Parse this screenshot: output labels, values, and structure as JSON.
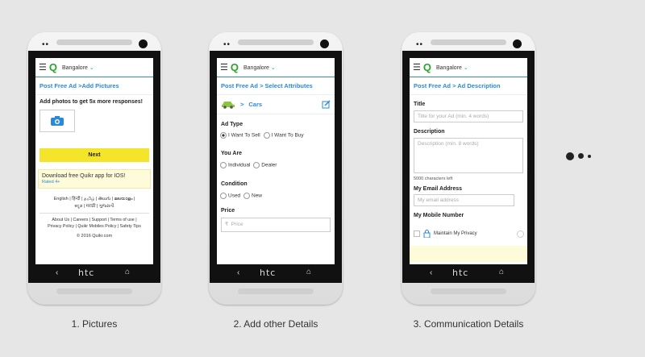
{
  "city": "Bangalore",
  "phones": [
    {
      "caption": "1. Pictures",
      "breadcrumb": "Post Free Ad >Add Pictures",
      "add_photos": "Add photos to get 5x more responses!",
      "next_label": "Next",
      "ios_promo": "Download free Quikr app for IOS!",
      "rated": "Rated 4+",
      "languages_line1": "English  |  हिन्दी  |  தமிழ்  |  తెలుగు  |  മലയാളം  |",
      "languages_line2": "ಕನ್ನಡ  |  मराठी  |  ગુજરાતી",
      "footer_line1": "About Us  |  Careers  |  Support  |  Terms of use  |",
      "footer_line2": "Privacy Policy  |  Quikr Mobiles Policy  |  Safety Tips",
      "copyright": "© 2016 Quikr.com"
    },
    {
      "caption": "2. Add other Details",
      "breadcrumb": "Post Free Ad > Select Attributes",
      "category": "Cars",
      "ad_type_label": "Ad Type",
      "ad_type_options": [
        "I Want To Sell",
        "I Want To Buy"
      ],
      "you_are_label": "You Are",
      "you_are_options": [
        "Individual",
        "Dealer"
      ],
      "condition_label": "Condition",
      "condition_options": [
        "Used",
        "New"
      ],
      "price_label": "Price",
      "price_placeholder": "Price",
      "rupee": "₹"
    },
    {
      "caption": "3. Communication Details",
      "breadcrumb": "Post Free Ad > Ad Description",
      "title_label": "Title",
      "title_placeholder": "Title for your Ad (min. 4 words)",
      "description_label": "Description",
      "description_placeholder": "Description (min. 8 words)",
      "chars_left": "5000 characters left",
      "email_label": "My Email Address",
      "email_placeholder": "My email address",
      "mobile_label": "My Mobile Number",
      "privacy_label": "Maintain My Privacy"
    }
  ],
  "navbar": {
    "back": "‹",
    "brand": "htc",
    "home": "⌂"
  },
  "colors": {
    "accent": "#2a8ad8",
    "logo": "#2aa52a",
    "next_button": "#f5e52a"
  }
}
